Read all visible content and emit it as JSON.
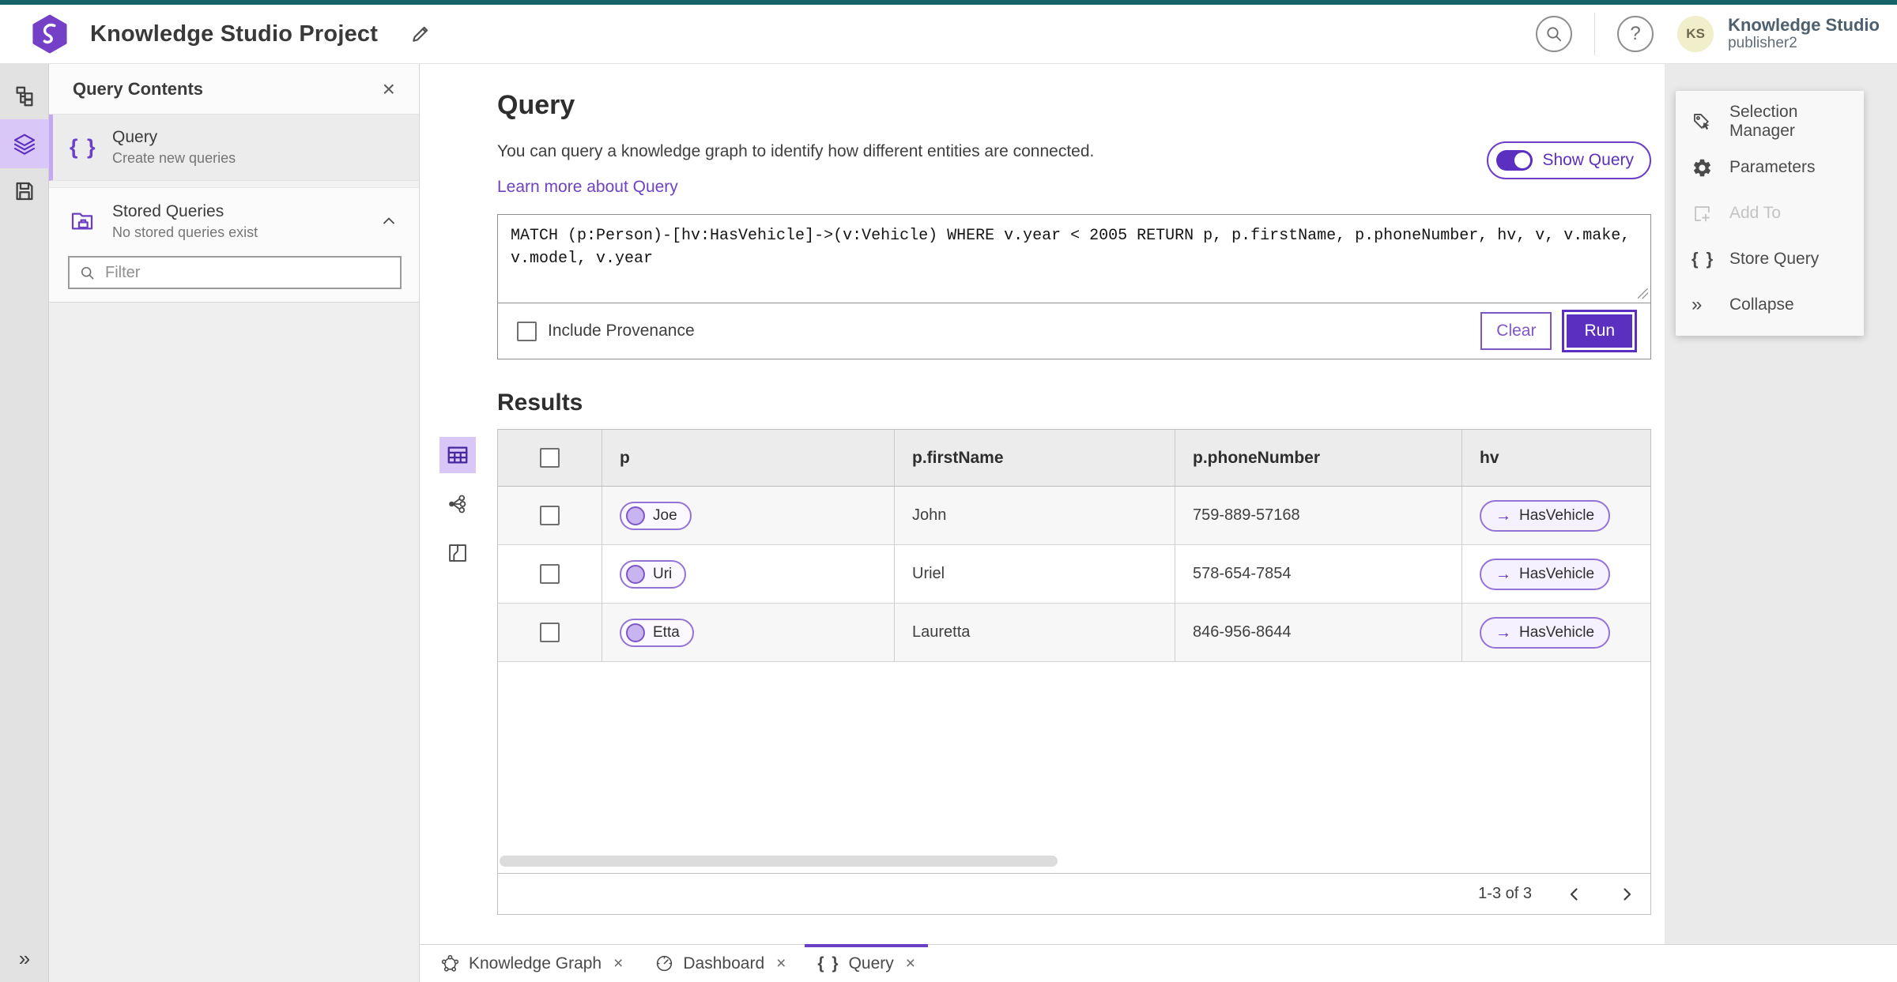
{
  "colors": {
    "accent": "#5b2fc0",
    "accent_border": "#6b40c6",
    "accent_selected_bg": "#d9c7f8",
    "link": "#6f42c1",
    "teal_top_bar": "#176468",
    "avatar_bg": "#f1eecb"
  },
  "icons": {
    "close": "×",
    "collapse": "»",
    "expand": "»",
    "braces": "{ }",
    "arrow_right": "→",
    "help": "?"
  },
  "header": {
    "project_title": "Knowledge Studio Project",
    "product_name": "Knowledge Studio",
    "user_name": "publisher2",
    "avatar_initials": "KS"
  },
  "left_panel": {
    "title": "Query Contents",
    "query_item": {
      "label": "Query",
      "description": "Create new queries"
    },
    "stored_item": {
      "label": "Stored Queries",
      "description": "No stored queries exist"
    },
    "filter_placeholder": "Filter"
  },
  "query_section": {
    "title": "Query",
    "description": "You can query a knowledge graph to identify how different entities are connected.",
    "learn_more": "Learn more about Query",
    "show_query_label": "Show Query",
    "query_text": "MATCH (p:Person)-[hv:HasVehicle]->(v:Vehicle) WHERE v.year < 2005 RETURN p, p.firstName, p.phoneNumber, hv, v, v.make, v.model, v.year",
    "include_provenance_label": "Include Provenance",
    "clear_label": "Clear",
    "run_label": "Run"
  },
  "results": {
    "title": "Results",
    "columns": [
      "p",
      "p.firstName",
      "p.phoneNumber",
      "hv"
    ],
    "rows": [
      {
        "p": "Joe",
        "firstName": "John",
        "phoneNumber": "759-889-57168",
        "hv": "HasVehicle"
      },
      {
        "p": "Uri",
        "firstName": "Uriel",
        "phoneNumber": "578-654-7854",
        "hv": "HasVehicle"
      },
      {
        "p": "Etta",
        "firstName": "Lauretta",
        "phoneNumber": "846-956-8644",
        "hv": "HasVehicle"
      }
    ],
    "pagination_label": "1-3 of 3"
  },
  "right_panel": {
    "items": [
      {
        "label": "Selection Manager"
      },
      {
        "label": "Parameters"
      },
      {
        "label": "Add To"
      },
      {
        "label": "Store Query"
      },
      {
        "label": "Collapse"
      }
    ]
  },
  "tabs": [
    {
      "label": "Knowledge Graph"
    },
    {
      "label": "Dashboard"
    },
    {
      "label": "Query"
    }
  ]
}
